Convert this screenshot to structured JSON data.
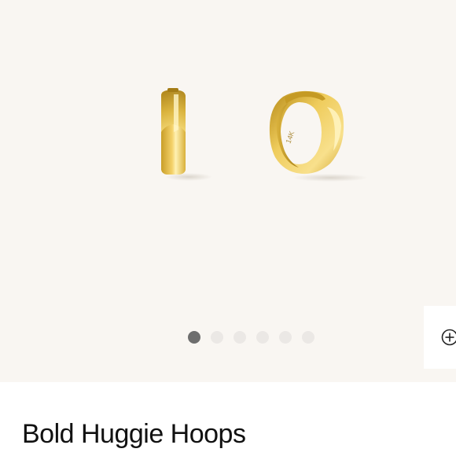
{
  "product": {
    "title": "Bold Huggie Hoops",
    "image": {
      "engraving": "14K",
      "colors": {
        "background": "#f9f6f2",
        "gold_light": "#fbe58a",
        "gold_mid": "#e5c248",
        "gold_dark": "#b98e1c"
      }
    }
  },
  "gallery": {
    "slide_count": 6,
    "active_slide": 1,
    "zoom_icon": "zoom-plus-icon"
  }
}
